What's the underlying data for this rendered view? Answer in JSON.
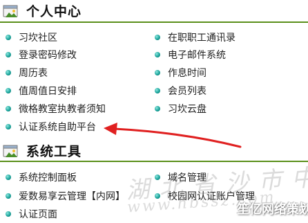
{
  "sections": [
    {
      "title": "个人中心",
      "icon": "window-app-icon",
      "items_left": [
        "习坎社区",
        "登录密码修改",
        "周历表",
        "值周值日安排",
        "微格教室执教者须知",
        "认证系统自助平台"
      ],
      "items_right": [
        "在职职工通讯录",
        "电子邮件系统",
        "作息时间",
        "会员列表",
        "习坎云盘"
      ]
    },
    {
      "title": "系统工具",
      "icon": "window-app-icon",
      "items_left": [
        "系统控制面板",
        "爱数易享云管理【内网】",
        "认证页面"
      ],
      "items_right": [
        "域名管理",
        "校园网认证账户管理"
      ]
    }
  ],
  "annotation": {
    "type": "red-arrow",
    "color": "#e02020",
    "points_to": "认证系统自助平台"
  },
  "watermarks": {
    "chinese": "湖北省沙市中学",
    "url": "www.hbssz.com",
    "logo": "笙亿网络策划"
  },
  "colors": {
    "header_rule": "#5a8f1a",
    "bullet": "#1aa39a",
    "arrow": "#e02020"
  }
}
